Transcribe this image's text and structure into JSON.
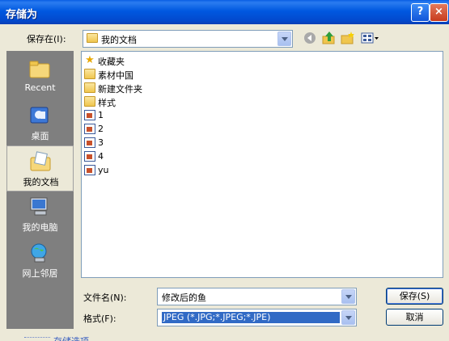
{
  "window": {
    "title": "存储为",
    "help_glyph": "?",
    "close_glyph": "×"
  },
  "toolbar": {
    "save_in_label": "保存在(I):",
    "save_in_value": "我的文档",
    "icons": [
      "back-icon",
      "up-folder-icon",
      "new-folder-icon",
      "view-menu-icon"
    ]
  },
  "places": [
    {
      "label": "Recent",
      "icon": "recent-folder-icon"
    },
    {
      "label": "桌面",
      "icon": "desktop-icon"
    },
    {
      "label": "我的文档",
      "icon": "my-documents-icon",
      "selected": true
    },
    {
      "label": "我的电脑",
      "icon": "my-computer-icon"
    },
    {
      "label": "网上邻居",
      "icon": "network-icon"
    }
  ],
  "files": [
    {
      "name": "收藏夹",
      "type": "favorites"
    },
    {
      "name": "素材中国",
      "type": "folder"
    },
    {
      "name": "新建文件夹",
      "type": "folder"
    },
    {
      "name": "样式",
      "type": "folder"
    },
    {
      "name": "1",
      "type": "file"
    },
    {
      "name": "2",
      "type": "file"
    },
    {
      "name": "3",
      "type": "file"
    },
    {
      "name": "4",
      "type": "file"
    },
    {
      "name": "yu",
      "type": "file"
    }
  ],
  "filename": {
    "label": "文件名(N):",
    "value": "修改后的鱼"
  },
  "format": {
    "label": "格式(F):",
    "value": "JPEG (*.JPG;*.JPEG;*.JPE)"
  },
  "buttons": {
    "save": "保存(S)",
    "cancel": "取消"
  },
  "options_link": "存储选项",
  "colors": {
    "title_bar": "#0058e0",
    "dialog_bg": "#ece9d8",
    "places_bg": "#7f7f7f",
    "selection": "#316ac5"
  }
}
